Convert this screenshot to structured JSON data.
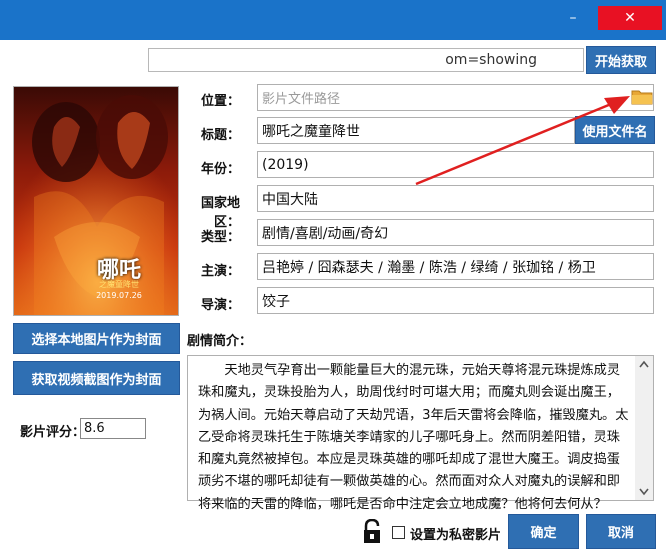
{
  "window": {
    "minimize_glyph": "–",
    "maximize_glyph": "□",
    "close_glyph": "✕"
  },
  "url_bar": {
    "value": "om=showing"
  },
  "fetch_button": "开始获取",
  "poster": {
    "caption_title": "哪吒",
    "caption_sub": "之魔童降世",
    "caption_date": "2019.07.26"
  },
  "form": {
    "location_label": "位置：",
    "location_placeholder": "影片文件路径",
    "title_label": "标题：",
    "title_value": "哪吒之魔童降世",
    "use_filename_button": "使用文件名",
    "year_label": "年份：",
    "year_value": "(2019)",
    "region_label": "国家地区：",
    "region_value": "中国大陆",
    "genre_label": "类型：",
    "genre_value": "剧情/喜剧/动画/奇幻",
    "cast_label": "主演：",
    "cast_value": "吕艳婷 / 囧森瑟夫 / 瀚墨 / 陈浩 / 绿绮 / 张珈铭 / 杨卫",
    "director_label": "导演：",
    "director_value": "饺子",
    "plot_label": "剧情简介：",
    "plot_value": "天地灵气孕育出一颗能量巨大的混元珠，元始天尊将混元珠提炼成灵珠和魔丸，灵珠投胎为人，助周伐纣时可堪大用；而魔丸则会诞出魔王，为祸人间。元始天尊启动了天劫咒语，3年后天雷将会降临，摧毁魔丸。太乙受命将灵珠托生于陈塘关李靖家的儿子哪吒身上。然而阴差阳错，灵珠和魔丸竟然被掉包。本应是灵珠英雄的哪吒却成了混世大魔王。调皮捣蛋顽劣不堪的哪吒却徒有一颗做英雄的心。然而面对众人对魔丸的误解和即将来临的天雷的降临，哪吒是否命中注定会立地成魔？他将何去何从？"
  },
  "left_panel": {
    "local_cover_button": "选择本地图片作为封面",
    "video_cover_button": "获取视频截图作为封面",
    "rating_label": "影片评分：",
    "rating_value": "8.6"
  },
  "footer": {
    "private_label": "设置为私密影片",
    "ok_button": "确定",
    "cancel_button": "取消"
  },
  "colors": {
    "titlebar": "#1a73c9",
    "button": "#2f6fb3",
    "close": "#e81123",
    "arrow": "#e02020"
  },
  "icons": [
    "minimize-icon",
    "maximize-icon",
    "close-icon",
    "folder-icon",
    "padlock-icon",
    "scroll-up-icon",
    "scroll-down-icon"
  ]
}
